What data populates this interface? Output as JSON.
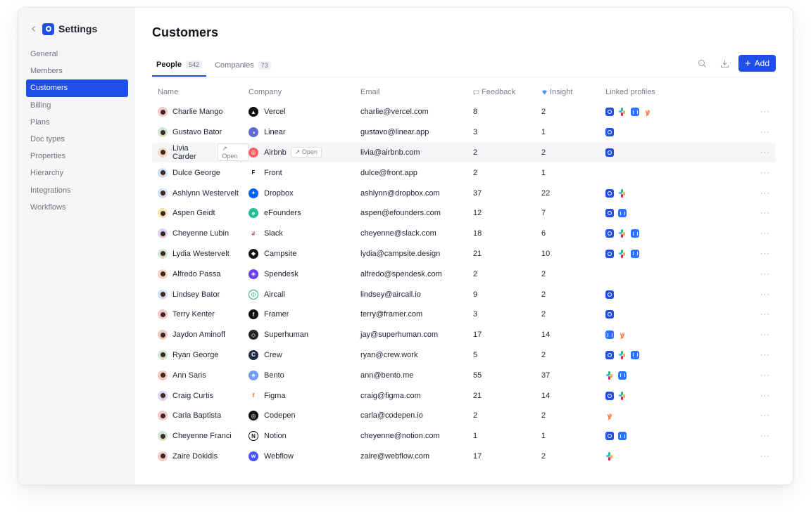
{
  "sidebar": {
    "title": "Settings",
    "items": [
      "General",
      "Members",
      "Customers",
      "Billing",
      "Plans",
      "Doc types",
      "Properties",
      "Hierarchy",
      "Integrations",
      "Workflows"
    ]
  },
  "main": {
    "title": "Customers",
    "tabs": [
      {
        "label": "People",
        "count": "542"
      },
      {
        "label": "Companies",
        "count": "73"
      }
    ],
    "add_label": "Add",
    "open_label": "Open",
    "more_label": "···"
  },
  "table": {
    "headers": {
      "name": "Name",
      "company": "Company",
      "email": "Email",
      "feedback": "Feedback",
      "insight": "Insight",
      "links": "Linked profiles"
    },
    "rows": [
      {
        "name": "Charlie Mango",
        "company": "Vercel",
        "email": "charlie@vercel.com",
        "feedback": "8",
        "insight": "2"
      },
      {
        "name": "Gustavo Bator",
        "company": "Linear",
        "email": "gustavo@linear.app",
        "feedback": "3",
        "insight": "1"
      },
      {
        "name": "Livia Carder",
        "company": "Airbnb",
        "email": "livia@airbnb.com",
        "feedback": "2",
        "insight": "2"
      },
      {
        "name": "Dulce George",
        "company": "Front",
        "email": "dulce@front.app",
        "feedback": "2",
        "insight": "1"
      },
      {
        "name": "Ashlynn Westervelt",
        "company": "Dropbox",
        "email": "ashlynn@dropbox.com",
        "feedback": "37",
        "insight": "22"
      },
      {
        "name": "Aspen Geidt",
        "company": "eFounders",
        "email": "aspen@efounders.com",
        "feedback": "12",
        "insight": "7"
      },
      {
        "name": "Cheyenne Lubin",
        "company": "Slack",
        "email": "cheyenne@slack.com",
        "feedback": "18",
        "insight": "6"
      },
      {
        "name": "Lydia Westervelt",
        "company": "Campsite",
        "email": "lydia@campsite.design",
        "feedback": "21",
        "insight": "10"
      },
      {
        "name": "Alfredo Passa",
        "company": "Spendesk",
        "email": "alfredo@spendesk.com",
        "feedback": "2",
        "insight": "2"
      },
      {
        "name": "Lindsey Bator",
        "company": "Aircall",
        "email": "lindsey@aircall.io",
        "feedback": "9",
        "insight": "2"
      },
      {
        "name": "Terry Kenter",
        "company": "Framer",
        "email": "terry@framer.com",
        "feedback": "3",
        "insight": "2"
      },
      {
        "name": "Jaydon Aminoff",
        "company": "Superhuman",
        "email": "jay@superhuman.com",
        "feedback": "17",
        "insight": "14"
      },
      {
        "name": "Ryan George",
        "company": "Crew",
        "email": "ryan@crew.work",
        "feedback": "5",
        "insight": "2"
      },
      {
        "name": "Ann Saris",
        "company": "Bento",
        "email": "ann@bento.me",
        "feedback": "55",
        "insight": "37"
      },
      {
        "name": "Craig Curtis",
        "company": "Figma",
        "email": "craig@figma.com",
        "feedback": "21",
        "insight": "14"
      },
      {
        "name": "Carla Baptista",
        "company": "Codepen",
        "email": "carla@codepen.io",
        "feedback": "2",
        "insight": "2"
      },
      {
        "name": "Cheyenne Franci",
        "company": "Notion",
        "email": "cheyenne@notion.com",
        "feedback": "1",
        "insight": "1"
      },
      {
        "name": "Zaire Dokidis",
        "company": "Webflow",
        "email": "zaire@webflow.com",
        "feedback": "17",
        "insight": "2"
      }
    ]
  },
  "colors": {
    "accent": "#1f4fe6",
    "hubspot": "#ff7a3d",
    "intercom": "#2c74ff"
  }
}
